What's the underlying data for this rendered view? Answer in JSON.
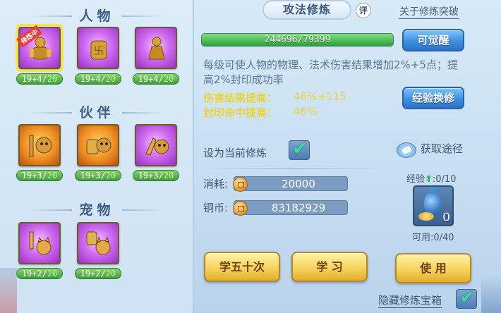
{
  "left_panel": {
    "sections": [
      {
        "title": "人物",
        "items": [
          {
            "icon": "character-warrior-icon",
            "level": "19+4/",
            "max": "20",
            "selected": true,
            "badge": "修炼中"
          },
          {
            "icon": "character-armor-icon",
            "level": "19+4/",
            "max": "20"
          },
          {
            "icon": "character-figure-icon",
            "level": "19+4/",
            "max": "20"
          }
        ]
      },
      {
        "title": "伙伴",
        "items": [
          {
            "icon": "partner-sword-lion-icon",
            "level": "19+3/",
            "max": "20"
          },
          {
            "icon": "partner-shield-lion-icon",
            "level": "19+3/",
            "max": "20"
          },
          {
            "icon": "partner-fist-lion-icon",
            "level": "19+3/",
            "max": "20"
          }
        ]
      },
      {
        "title": "宠物",
        "items": [
          {
            "icon": "pet-sword-cat-icon",
            "level": "19+2/",
            "max": "20"
          },
          {
            "icon": "pet-shield-cat-icon",
            "level": "19+2/",
            "max": "20"
          }
        ]
      }
    ]
  },
  "header": {
    "tab_title": "攻法修炼",
    "eval_badge": "评",
    "break_link": "关于修炼突破"
  },
  "progress": {
    "text": "244696/79399",
    "fill_fraction": 1.0
  },
  "buttons": {
    "awaken": "可觉醒",
    "exp_exchange": "经验换修",
    "learn_fifty": "学五十次",
    "learn": "学  习",
    "use": "使  用"
  },
  "description": "每级可使人物的物理、法术伤害结果增加2%+5点；提高2%封印成功率",
  "stats": [
    {
      "label": "伤害结果提高：",
      "value": "46%+115"
    },
    {
      "label": "封印命中提高：",
      "value": "46%"
    }
  ],
  "set_current": {
    "label": "设为当前修炼",
    "checked": true
  },
  "obtain": {
    "label": "获取途径"
  },
  "costs": {
    "consume_label": "消耗:",
    "consume_value": "20000",
    "coin_label": "铜币:",
    "coin_value": "83182929"
  },
  "treasure": {
    "exp_label": "经验",
    "exp_arrow": "⬆",
    "exp_value": ":0/10",
    "count": "0",
    "usable": "可用:0/40"
  },
  "hide_treasure": {
    "label": "隐藏修炼宝箱",
    "checked": true
  },
  "colors": {
    "accent_blue": "#3d8fe1",
    "stat_yellow": "#e9d43a",
    "progress_green": "#2f9f3a"
  }
}
